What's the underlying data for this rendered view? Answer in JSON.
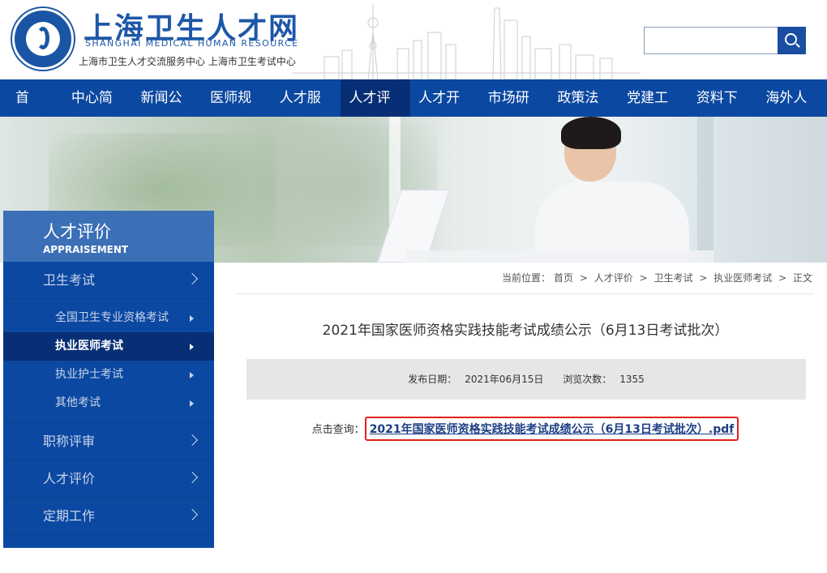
{
  "header": {
    "title": "上海卫生人才网",
    "subtitle_en": "SHANGHAI MEDICAL HUMAN RESOURCE",
    "subtitle_cn": "上海市卫生人才交流服务中心  上海市卫生考试中心",
    "search_placeholder": "",
    "logo_icon": "emblem-icon",
    "search_icon": "search-icon"
  },
  "nav": {
    "items": [
      "首页",
      "中心简介",
      "新闻公告",
      "医师规培",
      "人才服务",
      "人才评价",
      "人才开发",
      "市场研发",
      "政策法规",
      "党建工作",
      "资料下载",
      "海外人才"
    ],
    "active": "人才评价"
  },
  "sidebar": {
    "title_cn": "人才评价",
    "title_en": "APPRAISEMENT",
    "sections": [
      {
        "label": "卫生考试",
        "subs": [
          "全国卫生专业资格考试",
          "执业医师考试",
          "执业护士考试",
          "其他考试"
        ]
      },
      {
        "label": "职称评审"
      },
      {
        "label": "人才评价"
      },
      {
        "label": "定期工作"
      }
    ],
    "active_sub": "执业医师考试"
  },
  "breadcrumb": {
    "prefix": "当前位置：",
    "items": [
      "首页",
      "人才评价",
      "卫生考试",
      "执业医师考试",
      "正文"
    ],
    "separator": ">"
  },
  "article": {
    "title": "2021年国家医师资格实践技能考试成绩公示（6月13日考试批次）",
    "publish_label": "发布日期：",
    "publish_date": "2021年06月15日",
    "views_label": "浏览次数：",
    "views": "1355",
    "query_label": "点击查询：",
    "file_link": "2021年国家医师资格实践技能考试成绩公示（6月13日考试批次）.pdf"
  },
  "colors": {
    "brand_blue": "#0b48a1",
    "nav_active": "#082f75",
    "highlight_red": "#e0221c"
  }
}
